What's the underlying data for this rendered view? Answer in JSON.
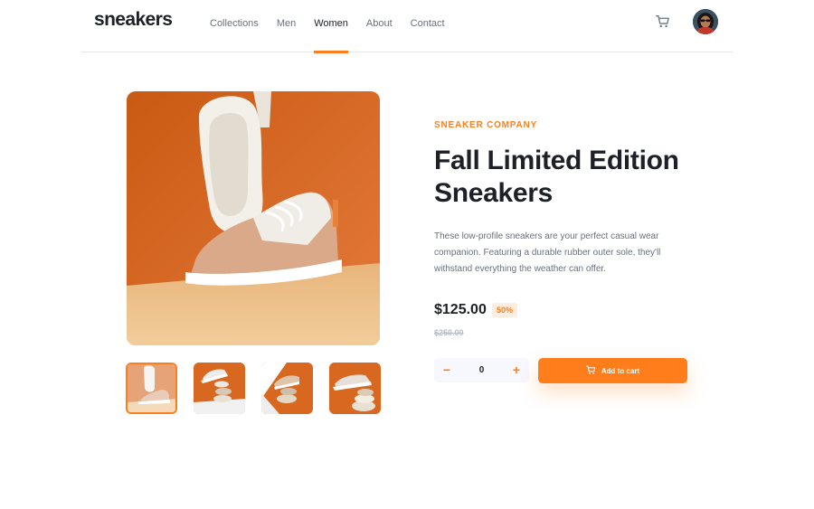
{
  "brand": {
    "logo": "sneakers"
  },
  "nav": {
    "items": [
      {
        "label": "Collections"
      },
      {
        "label": "Men"
      },
      {
        "label": "Women"
      },
      {
        "label": "About"
      },
      {
        "label": "Contact"
      }
    ],
    "active_item": "Women"
  },
  "header": {
    "cart_icon": "cart-icon",
    "avatar_icon": "user-avatar"
  },
  "gallery": {
    "thumbnails": [
      {
        "icon": "thumbnail-1",
        "selected": true
      },
      {
        "icon": "thumbnail-2",
        "selected": false
      },
      {
        "icon": "thumbnail-3",
        "selected": false
      },
      {
        "icon": "thumbnail-4",
        "selected": false
      }
    ]
  },
  "product": {
    "company": "SNEAKER COMPANY",
    "title_line1": "Fall Limited Edition",
    "title_line2": "Sneakers",
    "description": "These low-profile sneakers are your perfect casual wear companion. Featuring a durable rubber outer sole, they'll withstand everything the weather can offer.",
    "price": "$125.00",
    "discount": "50%",
    "original_price": "$250.00"
  },
  "cart": {
    "quantity": "0",
    "decrement_symbol": "−",
    "increment_symbol": "+",
    "add_to_cart_label": "Add to cart"
  },
  "colors": {
    "accent": "#ff7e1b",
    "accent_pale": "#ffede0",
    "text_dark": "#1d2026",
    "text_muted": "#69707d",
    "text_light": "#b6bcc8"
  }
}
